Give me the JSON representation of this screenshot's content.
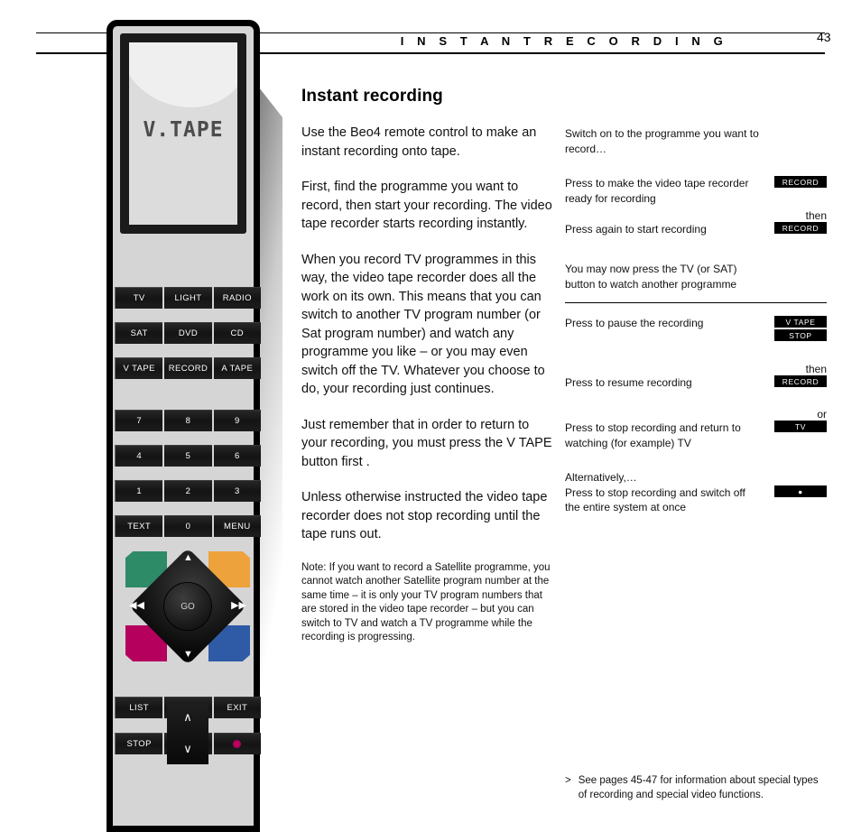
{
  "header": {
    "title": "I N S T A N T   R E C O R D I N G",
    "page_number": "43"
  },
  "remote": {
    "display_text": "V.TAPE",
    "button_rows": [
      [
        "TV",
        "LIGHT",
        "RADIO"
      ],
      [
        "SAT",
        "DVD",
        "CD"
      ],
      [
        "V TAPE",
        "RECORD",
        "A TAPE"
      ],
      [
        "7",
        "8",
        "9"
      ],
      [
        "4",
        "5",
        "6"
      ],
      [
        "1",
        "2",
        "3"
      ],
      [
        "TEXT",
        "0",
        "MENU"
      ]
    ],
    "nav": {
      "center_label": "GO",
      "up_glyph": "▲",
      "down_glyph": "▼",
      "left_glyph": "◀◀",
      "right_glyph": "▶▶",
      "color_top_left": "#2e8b68",
      "color_top_right": "#eda23c",
      "color_bottom_left": "#b5005e",
      "color_bottom_right": "#2f5ba6"
    },
    "bottom_rows": {
      "list_label": "LIST",
      "exit_label": "EXIT",
      "stop_label": "STOP",
      "standby_label": "●",
      "rocker_up": "∧",
      "rocker_down": "∨"
    }
  },
  "main": {
    "heading": "Instant recording",
    "paragraphs": [
      "Use the Beo4 remote control to make an instant recording onto tape.",
      "First, find the programme you want to record, then start your recording. The video tape recorder starts recording instantly.",
      "When you record TV programmes in this way, the video tape recorder does all the work on its own. This means that you can switch to another TV program number (or Sat program number) and watch any programme you like – or you may even switch off the TV. Whatever you choose to do, your recording just continues.",
      "Just remember that in order to return to your recording, you must press the V TAPE button first .",
      "Unless otherwise instructed the video tape recorder does not stop recording until the tape runs out."
    ],
    "note": "Note: If you want to record a Satellite programme, you cannot watch another Satellite program number at the same time – it is only your TV program numbers that are stored in the video tape recorder – but you can switch to TV and watch a TV programme while the recording is progressing."
  },
  "side": {
    "step1_text": "Switch on to the programme you want to record…",
    "step2_text": "Press to make the video tape recorder ready for recording",
    "step2_badge": "RECORD",
    "conj_then_1": "then",
    "step3_text": "Press again to start recording",
    "step3_badge": "RECORD",
    "step4_text": "You may now press the TV (or SAT) button to watch another programme",
    "step5_text": "Press to pause the recording",
    "step5_badge_a": "V TAPE",
    "step5_badge_b": "STOP",
    "conj_then_2": "then",
    "step6_text": "Press to resume recording",
    "step6_badge": "RECORD",
    "conj_or": "or",
    "step7_text": "Press to stop recording and return to watching (for example) TV",
    "step7_badge": "TV",
    "step8_intro": "Alternatively,…",
    "step8_text": "Press to stop recording and switch off the entire system at once",
    "step8_badge": "●"
  },
  "footnote": {
    "arrow": ">",
    "text": "See pages 45-47 for information about special types of recording and special video functions."
  }
}
